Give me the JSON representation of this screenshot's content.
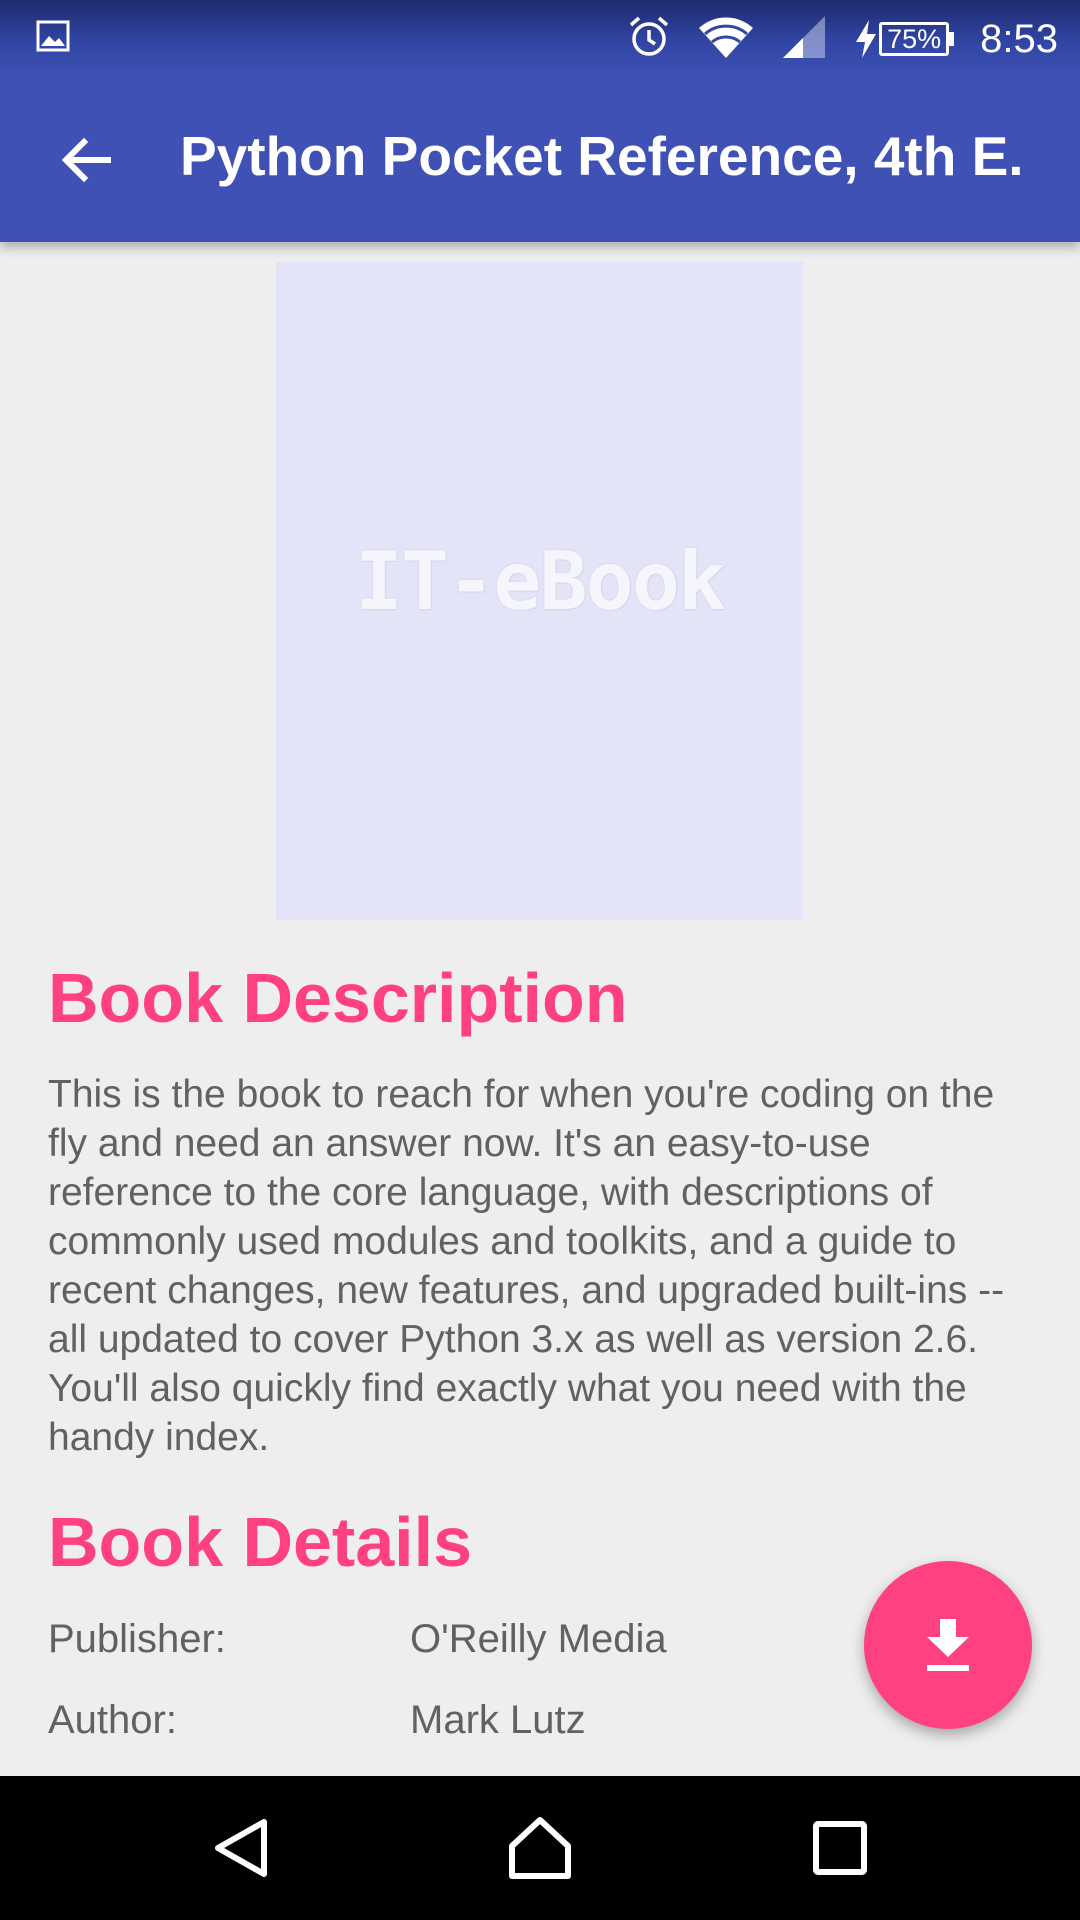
{
  "status_bar": {
    "time": "8:53",
    "battery_percent": "75%",
    "icons": [
      "image-notification-icon",
      "alarm-icon",
      "wifi-icon",
      "cell-signal-icon",
      "charging-icon",
      "battery-icon"
    ]
  },
  "app_bar": {
    "title": "Python Pocket Reference, 4th E.",
    "back_icon": "arrow-back-icon"
  },
  "cover": {
    "text": "IT-eBook",
    "background_color": "#e3e4f7"
  },
  "description": {
    "heading": "Book Description",
    "body": "This is the book to reach for when you're coding on the fly and need an answer now. It's an easy-to-use reference to the core language, with descriptions of commonly used modules and toolkits, and a guide to recent changes, new features, and upgraded built-ins -- all updated to cover Python 3.x as well as version 2.6. You'll also quickly find exactly what you need with the handy index."
  },
  "details": {
    "heading": "Book Details",
    "rows": [
      {
        "label": "Publisher:",
        "value": "O'Reilly Media"
      },
      {
        "label": "Author:",
        "value": "Mark Lutz"
      }
    ]
  },
  "fab": {
    "icon": "download-icon"
  },
  "nav_bar": {
    "icons": [
      "nav-back-icon",
      "nav-home-icon",
      "nav-recents-icon"
    ]
  },
  "colors": {
    "primary": "#3f51b5",
    "accent": "#ff4081",
    "background": "#eeeeee",
    "text_secondary": "#616161"
  }
}
